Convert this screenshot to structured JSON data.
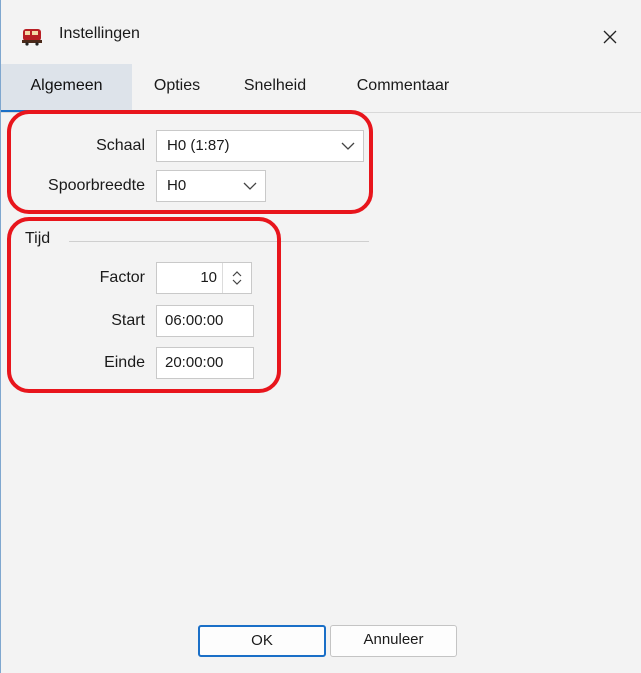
{
  "window": {
    "title": "Instellingen",
    "icon": "train-icon",
    "close_glyph": "✕"
  },
  "tabs": [
    {
      "label": "Algemeen",
      "active": true
    },
    {
      "label": "Opties",
      "active": false
    },
    {
      "label": "Snelheid",
      "active": false
    },
    {
      "label": "Commentaar",
      "active": false
    }
  ],
  "general": {
    "scale": {
      "label": "Schaal",
      "value": "H0 (1:87)"
    },
    "gauge": {
      "label": "Spoorbreedte",
      "value": "H0"
    }
  },
  "time_group": {
    "label": "Tijd",
    "factor": {
      "label": "Factor",
      "value": "10"
    },
    "start": {
      "label": "Start",
      "value": "06:00:00"
    },
    "end": {
      "label": "Einde",
      "value": "20:00:00"
    }
  },
  "buttons": {
    "ok": "OK",
    "cancel": "Annuleer"
  },
  "colors": {
    "accent": "#1a6fc7",
    "highlight": "#e8151c",
    "active_tab_bg": "#dde3ea"
  }
}
